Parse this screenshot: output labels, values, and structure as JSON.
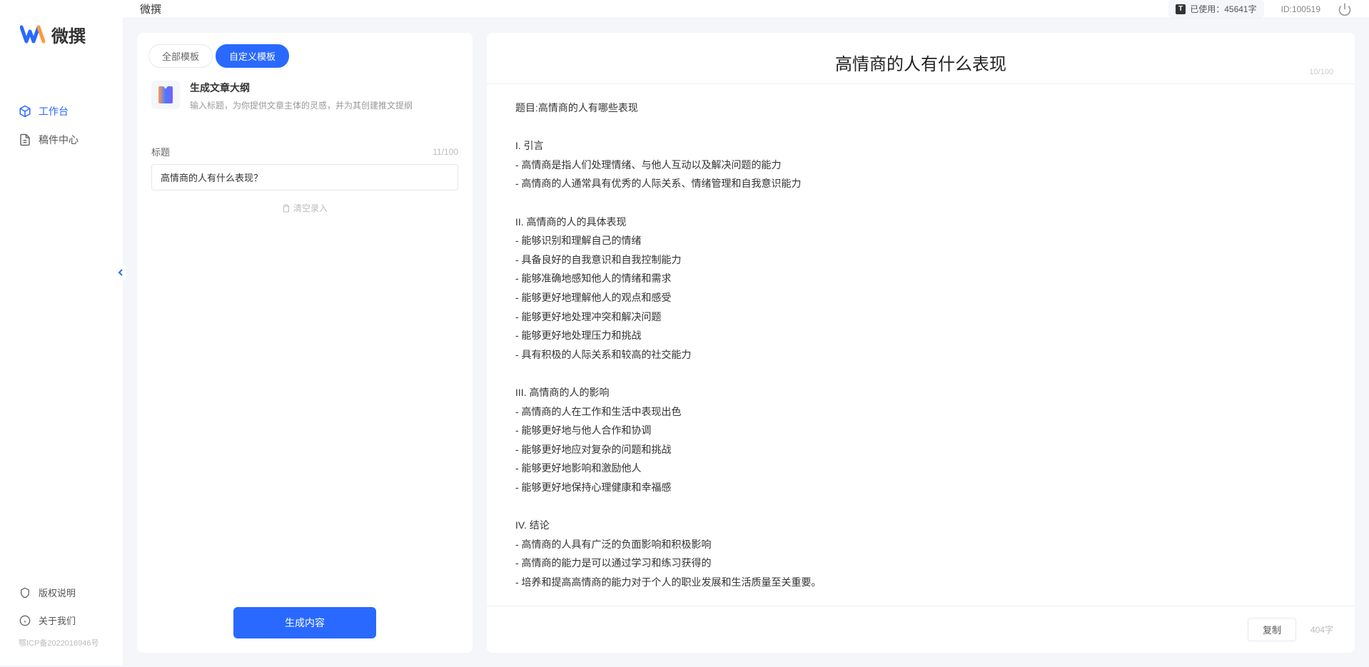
{
  "app": {
    "logo_text": "微撰",
    "title": "微撰"
  },
  "nav": {
    "workspace": "工作台",
    "drafts": "稿件中心",
    "copyright": "版权说明",
    "about": "关于我们",
    "icp": "鄂ICP备2022016946号"
  },
  "topbar": {
    "usage_label": "已使用：",
    "usage_value": "45641字",
    "user_id": "ID:100519"
  },
  "tabs": {
    "all": "全部模板",
    "custom": "自定义模板"
  },
  "template": {
    "title": "生成文章大纲",
    "desc": "输入标题，为你提供文章主体的灵感，并为其创建推文提纲"
  },
  "form": {
    "title_label": "标题",
    "title_count": "11/100",
    "title_value": "高情商的人有什么表现？",
    "clear_label": "清空录入",
    "generate": "生成内容"
  },
  "output": {
    "title": "高情商的人有什么表现",
    "title_count": "10/100",
    "body": "题目:高情商的人有哪些表现\n\nI. 引言\n- 高情商是指人们处理情绪、与他人互动以及解决问题的能力\n- 高情商的人通常具有优秀的人际关系、情绪管理和自我意识能力\n\nII. 高情商的人的具体表现\n- 能够识别和理解自己的情绪\n- 具备良好的自我意识和自我控制能力\n- 能够准确地感知他人的情绪和需求\n- 能够更好地理解他人的观点和感受\n- 能够更好地处理冲突和解决问题\n- 能够更好地处理压力和挑战\n- 具有积极的人际关系和较高的社交能力\n\nIII. 高情商的人的影响\n- 高情商的人在工作和生活中表现出色\n- 能够更好地与他人合作和协调\n- 能够更好地应对复杂的问题和挑战\n- 能够更好地影响和激励他人\n- 能够更好地保持心理健康和幸福感\n\nIV. 结论\n- 高情商的人具有广泛的负面影响和积极影响\n- 高情商的能力是可以通过学习和练习获得的\n- 培养和提高高情商的能力对于个人的职业发展和生活质量至关重要。",
    "copy": "复制",
    "word_count": "404字"
  }
}
